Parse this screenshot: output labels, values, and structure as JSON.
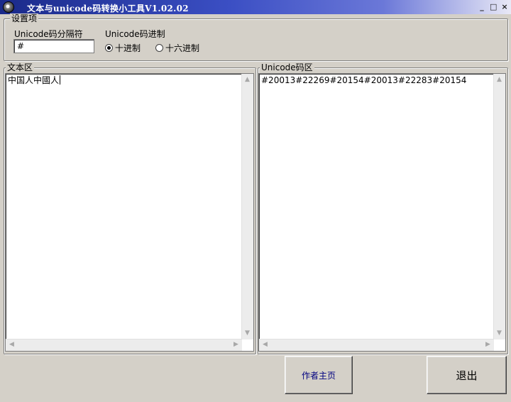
{
  "window": {
    "title": "文本与unicode码转换小工具V1.02.02",
    "controls": {
      "minimize": "_",
      "maximize": "□",
      "close": "×"
    }
  },
  "settings": {
    "legend": "设置项",
    "separator_label": "Unicode码分隔符",
    "separator_value": "#",
    "radix_label": "Unicode码进制",
    "radix_options": [
      {
        "label": "十进制",
        "selected": true
      },
      {
        "label": "十六进制",
        "selected": false
      }
    ]
  },
  "text_area": {
    "legend": "文本区",
    "content": "中国人中國人"
  },
  "unicode_area": {
    "legend": "Unicode码区",
    "content": "#20013#22269#20154#20013#22283#20154"
  },
  "buttons": {
    "author_home": "作者主页",
    "exit": "退出"
  }
}
